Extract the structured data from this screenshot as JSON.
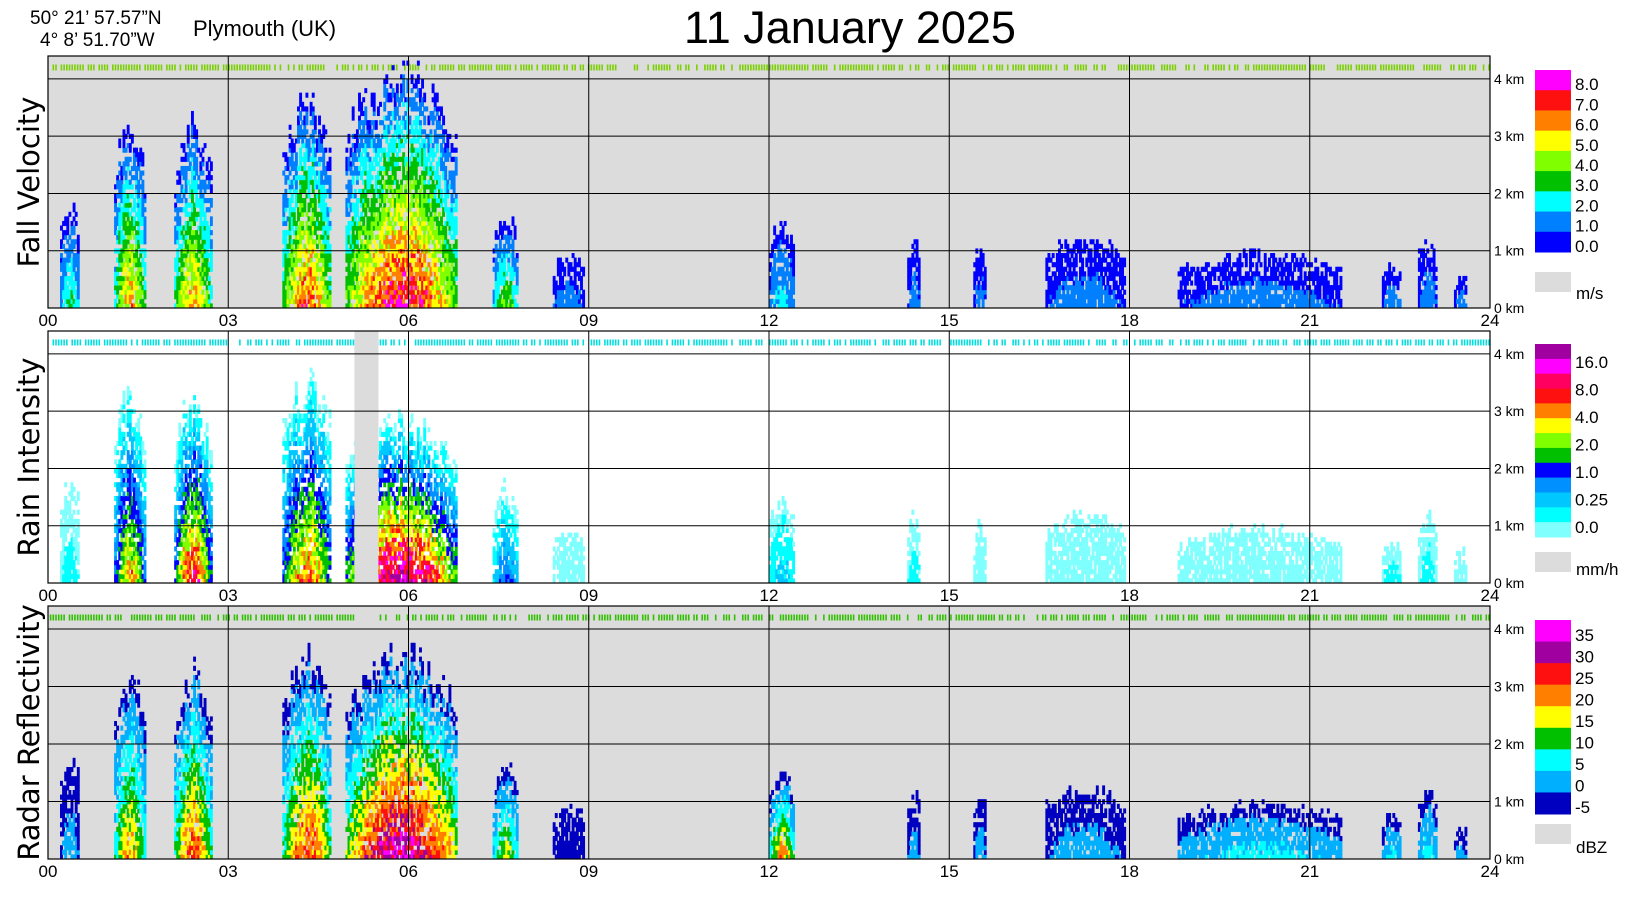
{
  "header": {
    "lat": "50° 21’ 57.57”N",
    "lon": "4°  8’ 51.70”W",
    "station": "Plymouth (UK)",
    "title": "11 January  2025"
  },
  "colors": {
    "panel_bg": "#dcdcdc",
    "missing": "#dcdcdc"
  },
  "chart_data": [
    {
      "type": "heatmap",
      "ylabel": "Fall Velocity",
      "x_ticks": [
        "00",
        "03",
        "06",
        "09",
        "12",
        "15",
        "18",
        "21",
        "24"
      ],
      "xlim": [
        0,
        24
      ],
      "y_ticks": [
        "0 km",
        "1 km",
        "2 km",
        "3 km",
        "4 km"
      ],
      "ylim_km": [
        0,
        4.4
      ],
      "background": "grey",
      "colorbar": {
        "unit": "m/s",
        "labels": [
          "8.0",
          "7.0",
          "6.0",
          "5.0",
          "4.0",
          "3.0",
          "2.0",
          "1.0",
          "0.0"
        ],
        "colors": [
          "#ff00ff",
          "#ff1010",
          "#ff8000",
          "#ffff00",
          "#80ff00",
          "#00c000",
          "#00ffff",
          "#0080ff",
          "#0000ff"
        ]
      },
      "status_strip_color": "#7ad000",
      "status_strip_gaps": [],
      "events": [
        {
          "t": [
            0.2,
            0.5
          ],
          "top": 2.0,
          "peak": 3
        },
        {
          "t": [
            1.1,
            1.6
          ],
          "top": 3.5,
          "peak": 6
        },
        {
          "t": [
            2.1,
            2.7
          ],
          "top": 3.5,
          "peak": 6
        },
        {
          "t": [
            3.9,
            4.7
          ],
          "top": 3.8,
          "peak": 7
        },
        {
          "t": [
            4.95,
            6.8
          ],
          "top": 4.4,
          "peak": 8
        },
        {
          "t": [
            7.4,
            7.8
          ],
          "top": 1.8,
          "peak": 4
        },
        {
          "t": [
            8.4,
            8.9
          ],
          "top": 1.0,
          "peak": 1
        },
        {
          "t": [
            12.0,
            12.4
          ],
          "top": 1.6,
          "peak": 2
        },
        {
          "t": [
            14.3,
            14.5
          ],
          "top": 1.3,
          "peak": 1
        },
        {
          "t": [
            15.4,
            15.6
          ],
          "top": 1.2,
          "peak": 1
        },
        {
          "t": [
            16.6,
            17.9
          ],
          "top": 1.3,
          "peak": 1
        },
        {
          "t": [
            18.8,
            21.5
          ],
          "top": 1.0,
          "peak": 1
        },
        {
          "t": [
            22.2,
            22.5
          ],
          "top": 0.8,
          "peak": 1
        },
        {
          "t": [
            22.8,
            23.1
          ],
          "top": 1.3,
          "peak": 1
        },
        {
          "t": [
            23.4,
            23.6
          ],
          "top": 0.6,
          "peak": 1
        }
      ]
    },
    {
      "type": "heatmap",
      "ylabel": "Rain Intensity",
      "x_ticks": [
        "00",
        "03",
        "06",
        "09",
        "12",
        "15",
        "18",
        "21",
        "24"
      ],
      "xlim": [
        0,
        24
      ],
      "y_ticks": [
        "0 km",
        "1 km",
        "2 km",
        "3 km",
        "4 km"
      ],
      "ylim_km": [
        0,
        4.4
      ],
      "background": "white",
      "colorbar": {
        "unit": "mm/h",
        "labels": [
          "16.0",
          "8.0",
          "4.0",
          "2.0",
          "1.0",
          "0.25",
          "0.0"
        ],
        "colors": [
          "#a000a0",
          "#ff00ff",
          "#ff0060",
          "#ff1010",
          "#ff8000",
          "#ffff00",
          "#80ff00",
          "#00c000",
          "#0000ff",
          "#0090ff",
          "#00c8ff",
          "#00ffff",
          "#80ffff"
        ]
      },
      "status_strip_color": "#00e0e0",
      "missing_block": [
        5.1,
        5.5
      ],
      "events": [
        {
          "t": [
            0.2,
            0.5
          ],
          "top": 2.0,
          "peak": 1
        },
        {
          "t": [
            1.1,
            1.6
          ],
          "top": 3.5,
          "peak": 8
        },
        {
          "t": [
            2.1,
            2.7
          ],
          "top": 3.5,
          "peak": 10
        },
        {
          "t": [
            3.9,
            4.7
          ],
          "top": 3.8,
          "peak": 9
        },
        {
          "t": [
            4.95,
            6.8
          ],
          "top": 3.0,
          "peak": 12
        },
        {
          "t": [
            7.4,
            7.8
          ],
          "top": 1.8,
          "peak": 4
        },
        {
          "t": [
            8.4,
            8.9
          ],
          "top": 1.0,
          "peak": 0
        },
        {
          "t": [
            12.0,
            12.4
          ],
          "top": 1.6,
          "peak": 2
        },
        {
          "t": [
            14.3,
            14.5
          ],
          "top": 1.3,
          "peak": 1
        },
        {
          "t": [
            15.4,
            15.6
          ],
          "top": 1.2,
          "peak": 0
        },
        {
          "t": [
            16.6,
            17.9
          ],
          "top": 1.3,
          "peak": 0
        },
        {
          "t": [
            18.8,
            21.5
          ],
          "top": 1.0,
          "peak": 0
        },
        {
          "t": [
            22.2,
            22.5
          ],
          "top": 0.8,
          "peak": 1
        },
        {
          "t": [
            22.8,
            23.1
          ],
          "top": 1.3,
          "peak": 1
        },
        {
          "t": [
            23.4,
            23.6
          ],
          "top": 0.6,
          "peak": 0
        }
      ]
    },
    {
      "type": "heatmap",
      "ylabel": "Radar Reflectivity",
      "x_ticks": [
        "00",
        "03",
        "06",
        "09",
        "12",
        "15",
        "18",
        "21",
        "24"
      ],
      "xlim": [
        0,
        24
      ],
      "y_ticks": [
        "0 km",
        "1 km",
        "2 km",
        "3 km",
        "4 km"
      ],
      "ylim_km": [
        0,
        4.4
      ],
      "background": "grey",
      "colorbar": {
        "unit": "dBZ",
        "labels": [
          "35",
          "30",
          "25",
          "20",
          "15",
          "10",
          "5",
          "0",
          "-5"
        ],
        "colors": [
          "#ff00ff",
          "#a000a0",
          "#ff1010",
          "#ff8000",
          "#ffff00",
          "#00c000",
          "#00ffff",
          "#00b0ff",
          "#0000c0"
        ]
      },
      "status_strip_color": "#30c000",
      "status_strip_gaps": [
        [
          5.1,
          5.5
        ]
      ],
      "events": [
        {
          "t": [
            0.2,
            0.5
          ],
          "top": 2.0,
          "peak": 1
        },
        {
          "t": [
            1.1,
            1.6
          ],
          "top": 3.5,
          "peak": 5
        },
        {
          "t": [
            2.1,
            2.7
          ],
          "top": 3.5,
          "peak": 6
        },
        {
          "t": [
            3.9,
            4.7
          ],
          "top": 3.8,
          "peak": 6
        },
        {
          "t": [
            4.95,
            6.8
          ],
          "top": 3.8,
          "peak": 8
        },
        {
          "t": [
            7.4,
            7.8
          ],
          "top": 1.8,
          "peak": 4
        },
        {
          "t": [
            8.4,
            8.9
          ],
          "top": 1.0,
          "peak": 0
        },
        {
          "t": [
            12.0,
            12.4
          ],
          "top": 1.6,
          "peak": 5
        },
        {
          "t": [
            14.3,
            14.5
          ],
          "top": 1.3,
          "peak": 1
        },
        {
          "t": [
            15.4,
            15.6
          ],
          "top": 1.2,
          "peak": 1
        },
        {
          "t": [
            16.6,
            17.9
          ],
          "top": 1.3,
          "peak": 1
        },
        {
          "t": [
            18.8,
            21.5
          ],
          "top": 1.0,
          "peak": 2
        },
        {
          "t": [
            22.2,
            22.5
          ],
          "top": 0.8,
          "peak": 2
        },
        {
          "t": [
            22.8,
            23.1
          ],
          "top": 1.3,
          "peak": 2
        },
        {
          "t": [
            23.4,
            23.6
          ],
          "top": 0.6,
          "peak": 1
        }
      ]
    }
  ]
}
